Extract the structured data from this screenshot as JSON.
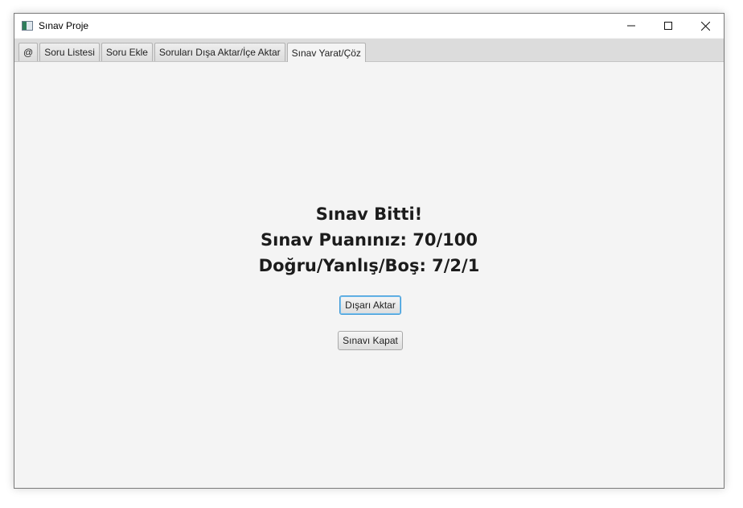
{
  "window": {
    "title": "Sınav Proje",
    "controls": {
      "minimize": "—",
      "maximize": "☐",
      "close": "✕"
    }
  },
  "tabs": [
    {
      "label": "@"
    },
    {
      "label": "Soru Listesi"
    },
    {
      "label": "Soru Ekle"
    },
    {
      "label": "Soruları Dışa Aktar/İçe Aktar"
    },
    {
      "label": "Sınav Yarat/Çöz",
      "active": true
    }
  ],
  "result": {
    "finished": "Sınav Bitti!",
    "score": "Sınav Puanınız: 70/100",
    "counts": "Doğru/Yanlış/Boş: 7/2/1"
  },
  "buttons": {
    "export": "Dışarı Aktar",
    "close_exam": "Sınavı Kapat"
  },
  "colors": {
    "focus_accent": "#3e9ad8",
    "background": "#f4f4f4"
  }
}
